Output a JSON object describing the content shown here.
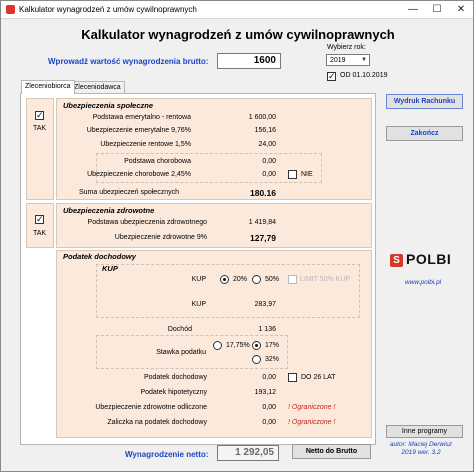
{
  "window": {
    "title": "Kalkulator wynagrodzeń z umów cywilnoprawnych",
    "minimize_glyph": "—",
    "maximize_glyph": "☐",
    "close_glyph": "✕"
  },
  "header": {
    "title": "Kalkulator wynagrodzeń z umów cywilnoprawnych",
    "gross_label": "Wprowadź wartość wynagrodzenia brutto:",
    "gross_value": "1600",
    "year_label": "Wybierz rok:",
    "year_value": "2019",
    "date_check_label": "OD 01.10.2019",
    "date_check_checked": true
  },
  "tabs": [
    {
      "label": "Zleceniobiorca",
      "active": true
    },
    {
      "label": "Zleceniodawca",
      "active": false
    }
  ],
  "social": {
    "enabled_label": "TAK",
    "enabled": true,
    "title": "Ubezpieczenia społeczne",
    "rows": [
      {
        "label": "Podstawa emerytalno - rentowa",
        "value": "1 600,00"
      },
      {
        "label": "Ubezpieczenie emerytalne 9,76%",
        "value": "156,16"
      },
      {
        "label": "Ubezpieczenie rentowe 1,5%",
        "value": "24,00"
      }
    ],
    "sickness_rows": [
      {
        "label": "Podstawa chorobowa",
        "value": "0,00"
      },
      {
        "label": "Ubezpieczenie chorobowe 2,45%",
        "value": "0,00"
      }
    ],
    "sickness_check_label": "NIE",
    "sickness_checked": false,
    "sum_label": "Suma ubezpieczeń społecznych",
    "sum_value": "180.16"
  },
  "health": {
    "enabled_label": "TAK",
    "enabled": true,
    "title": "Ubezpieczenia zdrowotne",
    "rows": [
      {
        "label": "Podstawa ubezpieczenia zdrowotnego",
        "value": "1 419,84"
      },
      {
        "label": "Ubezpieczenie zdrowotne 9%",
        "value": "127,79"
      }
    ]
  },
  "tax": {
    "title": "Podatek dochodowy",
    "kup_title": "KUP",
    "kup_label": "KUP",
    "kup_options": [
      {
        "label": "20%",
        "selected": true
      },
      {
        "label": "50%",
        "selected": false
      }
    ],
    "kup_limit_label": "LIMIT 50% KUP",
    "kup_value_label": "KUP",
    "kup_value": "283,97",
    "income_label": "Dochód",
    "income_value": "1 136",
    "rate_label": "Stawka podatku",
    "rate_options": [
      {
        "label": "17,75%",
        "selected": false
      },
      {
        "label": "17%",
        "selected": true
      },
      {
        "label": "32%",
        "selected": false
      }
    ],
    "rows": [
      {
        "label": "Podatek dochodowy",
        "value": "0,00",
        "note": ""
      },
      {
        "label": "Podatek hipotetyczny",
        "value": "193,12",
        "note": ""
      },
      {
        "label": "Ubezpieczenie zdrowotne odliczone",
        "value": "0,00",
        "note": "! Ograniczone !"
      },
      {
        "label": "Zaliczka na podatek dochodowy",
        "value": "0,00",
        "note": "! Ograniczone !"
      }
    ],
    "under26_label": "DO 26 LAT",
    "under26_checked": false
  },
  "footer": {
    "net_label": "Wynagrodzenie netto:",
    "net_value": "1 292,05",
    "net_to_gross_button": "Netto do Brutto"
  },
  "side": {
    "print_button": "Wydruk Rachunku",
    "exit_button": "Zakończ",
    "logo_letter": "S",
    "logo_text": "POLBI",
    "logo_url": "www.polbi.pl",
    "other_programs_button": "Inne programy",
    "author_line1": "autor: Maciej Derwisz",
    "author_line2": "2019  wer. 3.2"
  },
  "colors": {
    "accent_blue": "#1c46c8",
    "group_background": "#fbe9dc",
    "warning_red": "#cc1f1f",
    "logo_red": "#d43a2a"
  }
}
